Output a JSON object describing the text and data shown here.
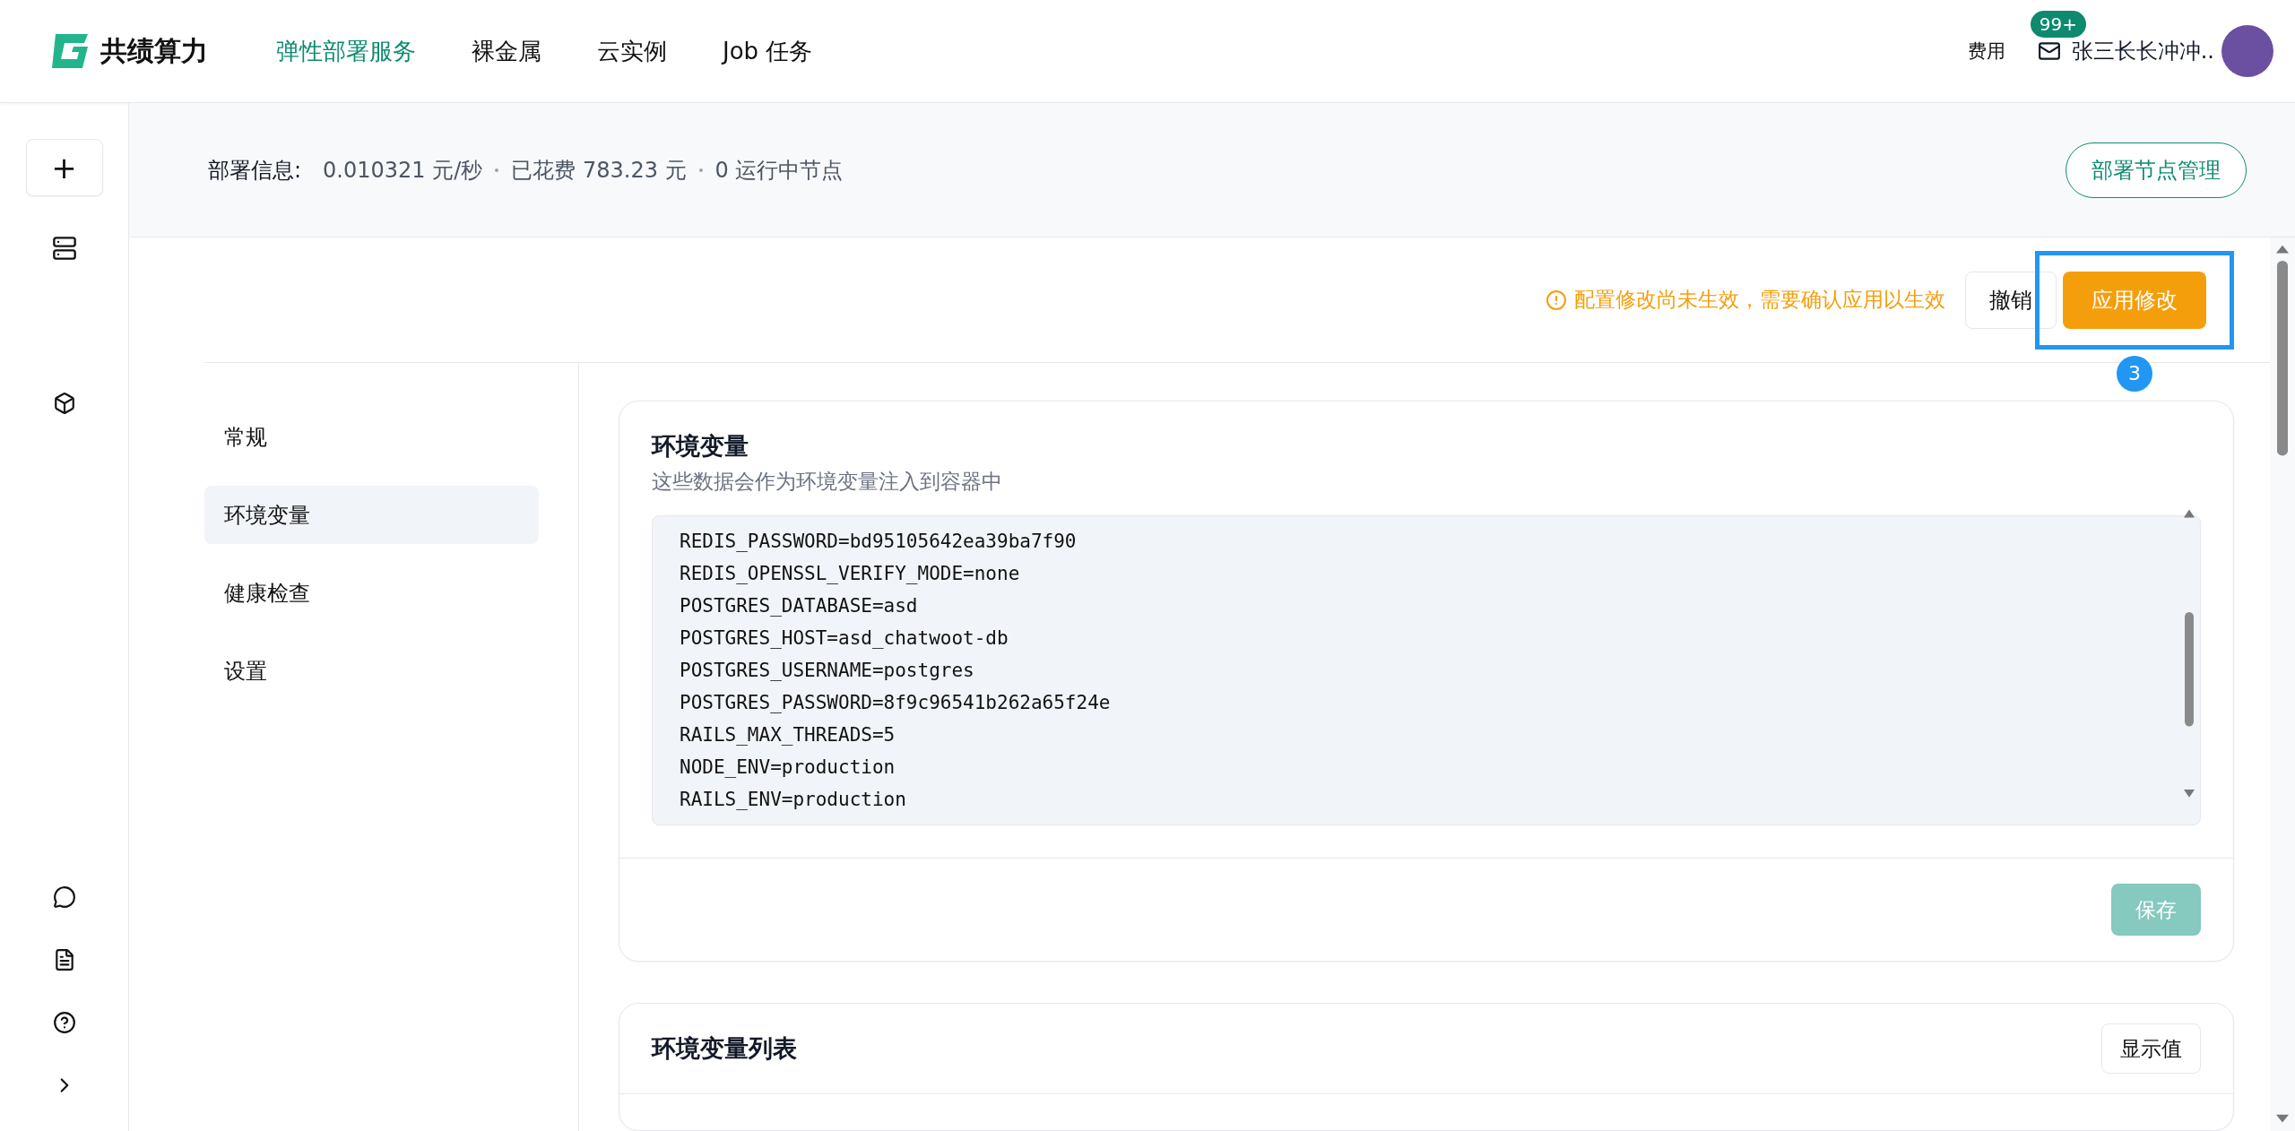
{
  "header": {
    "logo_text": "共绩算力",
    "nav": [
      {
        "label": "弹性部署服务",
        "selected": true
      },
      {
        "label": "裸金属",
        "selected": false
      },
      {
        "label": "云实例",
        "selected": false
      },
      {
        "label": "Job 任务",
        "selected": false
      }
    ],
    "fee_link": "费用",
    "mail_badge": "99+",
    "user_name": "张三长长冲冲.."
  },
  "rail": {
    "add_button": "+"
  },
  "info_bar": {
    "label": "部署信息:",
    "rate": "0.010321 元/秒",
    "spent": "已花费 783.23 元",
    "nodes": "0 运行中节点",
    "button": "部署节点管理"
  },
  "action_bar": {
    "warning": "配置修改尚未生效，需要确认应用以生效",
    "cancel": "撤销",
    "apply": "应用修改",
    "step_badge": "3"
  },
  "subnav": [
    {
      "label": "常规",
      "selected": false
    },
    {
      "label": "环境变量",
      "selected": true
    },
    {
      "label": "健康检查",
      "selected": false
    },
    {
      "label": "设置",
      "selected": false
    }
  ],
  "env_card": {
    "title": "环境变量",
    "subtitle": "这些数据会作为环境变量注入到容器中",
    "lines": [
      "REDIS_PASSWORD=bd95105642ea39ba7f90",
      "REDIS_OPENSSL_VERIFY_MODE=none",
      "POSTGRES_DATABASE=asd",
      "POSTGRES_HOST=asd_chatwoot-db",
      "POSTGRES_USERNAME=postgres",
      "POSTGRES_PASSWORD=8f9c96541b262a65f24e",
      "RAILS_MAX_THREADS=5",
      "NODE_ENV=production",
      "RAILS_ENV=production"
    ],
    "save_button": {
      "label": "保存",
      "disabled": true
    }
  },
  "list_card": {
    "title": "环境变量列表",
    "button": "显示值"
  }
}
